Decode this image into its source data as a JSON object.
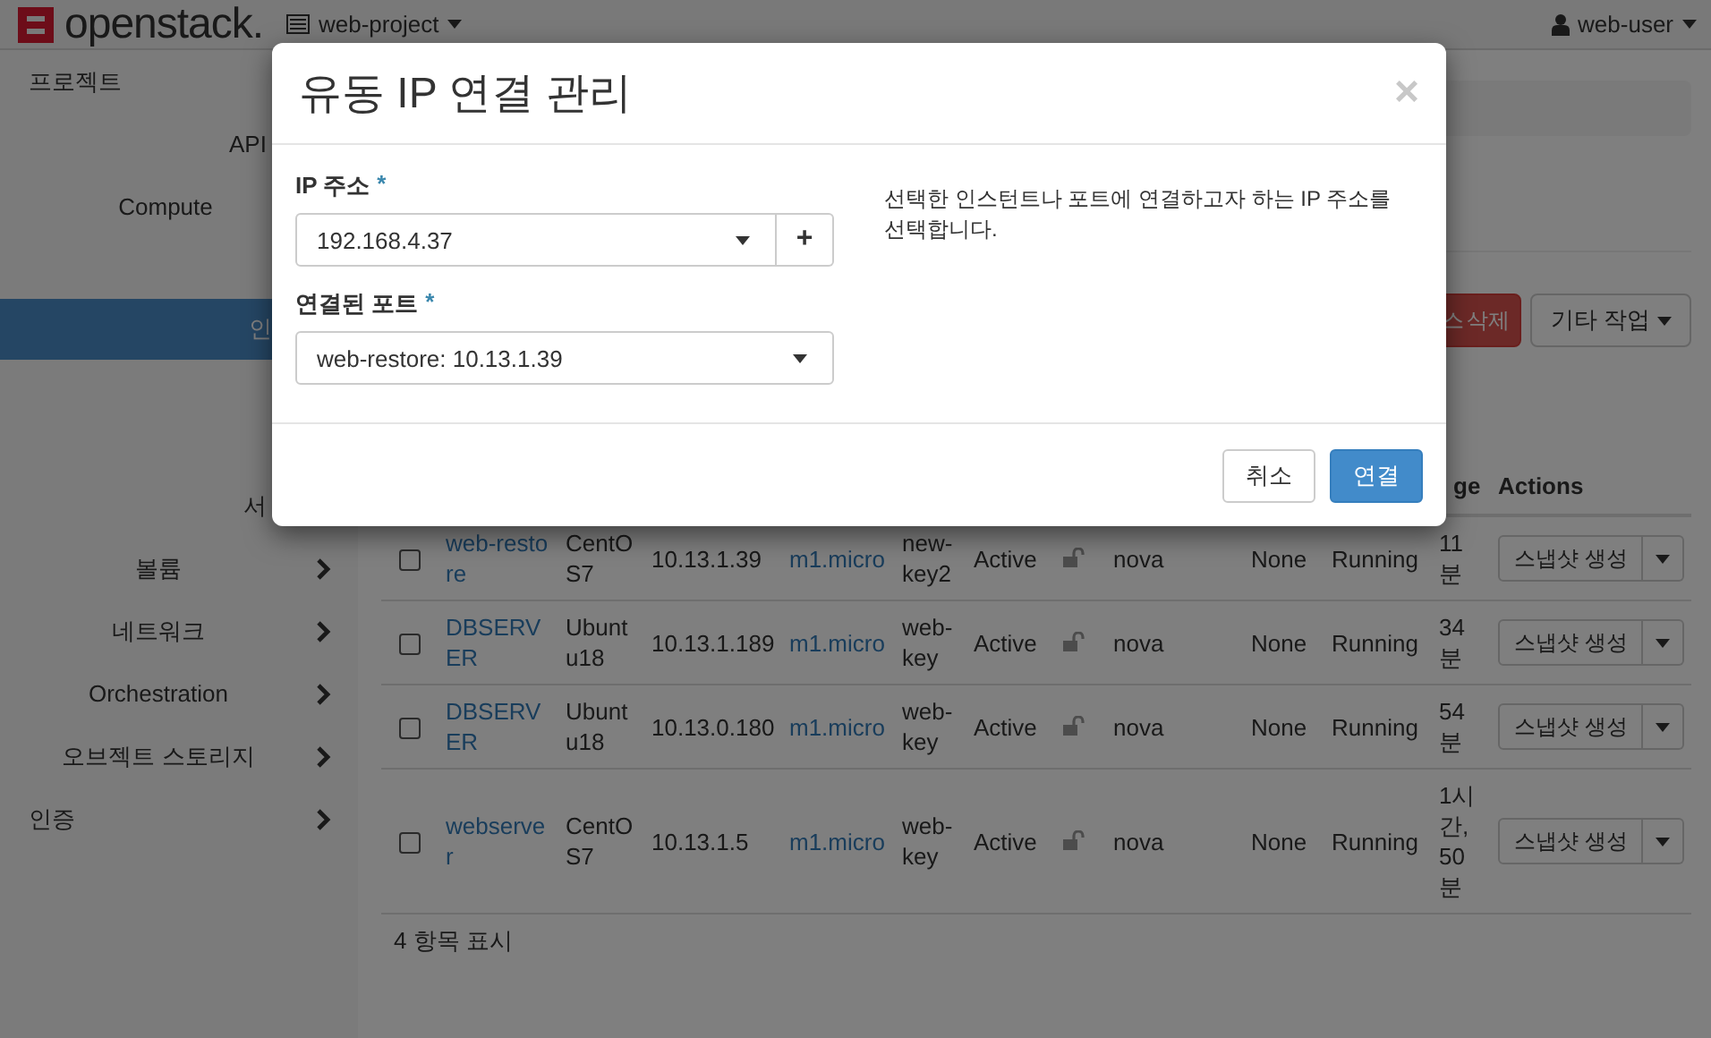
{
  "topbar": {
    "logo": "openstack.",
    "project": "web-project",
    "user": "web-user"
  },
  "sidebar": {
    "items": [
      {
        "label": "프로젝트",
        "kind": "heading",
        "selected": false
      },
      {
        "label": "API",
        "kind": "covered",
        "selected": false
      },
      {
        "label": "Compute",
        "kind": "link",
        "selected": false
      },
      {
        "label": "인",
        "kind": "covered",
        "selected": true
      },
      {
        "label": "서",
        "kind": "covered",
        "selected": false
      },
      {
        "label": "볼륨",
        "kind": "group",
        "selected": false
      },
      {
        "label": "네트워크",
        "kind": "group",
        "selected": false
      },
      {
        "label": "Orchestration",
        "kind": "group",
        "selected": false
      },
      {
        "label": "오브젝트 스토리지",
        "kind": "group",
        "selected": false
      },
      {
        "label": "인증",
        "kind": "section",
        "selected": false
      }
    ]
  },
  "actions": [
    {
      "label": "스 삭제",
      "kind": "danger"
    },
    {
      "label": "기타 작업",
      "kind": "dropdown"
    }
  ],
  "table": {
    "header": {
      "age": "ge",
      "actions": "Actions"
    },
    "rows": [
      {
        "checked": false,
        "name": "web-restore",
        "image": "CentOS7",
        "ip": "10.13.1.39",
        "flavor": "m1.micro",
        "key": "new-key2",
        "status": "Active",
        "zone": "nova",
        "task": "None",
        "power": "Running",
        "age": "11 분",
        "action": "스냅샷 생성"
      },
      {
        "checked": false,
        "name": "DBSERVER",
        "image": "Ubuntu18",
        "ip": "10.13.1.189",
        "flavor": "m1.micro",
        "key": "web-key",
        "status": "Active",
        "zone": "nova",
        "task": "None",
        "power": "Running",
        "age": "34 분",
        "action": "스냅샷 생성"
      },
      {
        "checked": false,
        "name": "DBSERVER",
        "image": "Ubuntu18",
        "ip": "10.13.0.180",
        "flavor": "m1.micro",
        "key": "web-key",
        "status": "Active",
        "zone": "nova",
        "task": "None",
        "power": "Running",
        "age": "54 분",
        "action": "스냅샷 생성"
      },
      {
        "checked": false,
        "name": "webserver",
        "image": "CentOS7",
        "ip": "10.13.1.5",
        "flavor": "m1.micro",
        "key": "web-key",
        "status": "Active",
        "zone": "nova",
        "task": "None",
        "power": "Running",
        "age": "1시간, 50 분",
        "action": "스냅샷 생성"
      }
    ],
    "footer": "4 항목 표시"
  },
  "modal": {
    "title": "유동 IP 연결 관리",
    "close": "×",
    "fields": [
      {
        "label": "IP 주소",
        "required": "*",
        "value": "192.168.4.37",
        "add": "+"
      },
      {
        "label": "연결된 포트",
        "required": "*",
        "value": "web-restore: 10.13.1.39"
      }
    ],
    "help": "선택한 인스턴트나 포트에 연결하고자 하는 IP 주소를 선택합니다.",
    "buttons": [
      {
        "label": "취소",
        "kind": "default"
      },
      {
        "label": "연결",
        "kind": "primary"
      }
    ]
  }
}
